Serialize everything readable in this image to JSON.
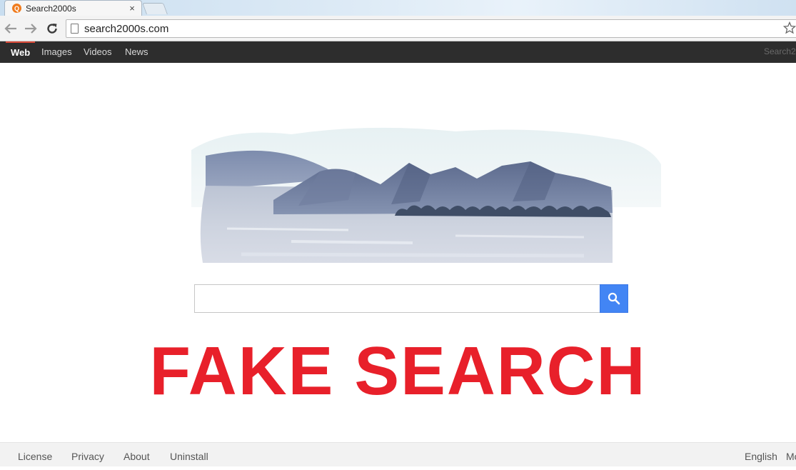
{
  "browser": {
    "tab_title": "Search2000s",
    "favicon_letter": "Q",
    "tab_close": "×",
    "url": "search2000s.com"
  },
  "sitenav": {
    "items": [
      {
        "label": "Web",
        "active": true
      },
      {
        "label": "Images",
        "active": false
      },
      {
        "label": "Videos",
        "active": false
      },
      {
        "label": "News",
        "active": false
      }
    ],
    "brand": "Search2"
  },
  "search": {
    "value": "",
    "placeholder": ""
  },
  "overlay_text": "FAKE SEARCH",
  "footer": {
    "links": [
      "License",
      "Privacy",
      "About",
      "Uninstall"
    ],
    "language": "English",
    "more": "Mo"
  },
  "colors": {
    "nav_bar": "#2d2d2d",
    "search_button": "#4285f4",
    "overlay": "#e8202a",
    "favicon": "#f07b1d"
  }
}
